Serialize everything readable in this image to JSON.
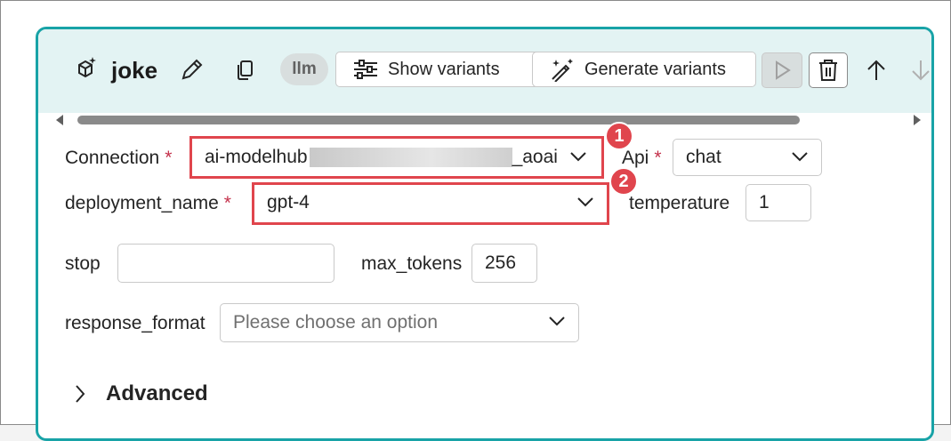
{
  "node": {
    "title": "joke",
    "badge": "llm",
    "buttons": {
      "show_variants": "Show variants",
      "generate_variants": "Generate variants"
    }
  },
  "form": {
    "connection": {
      "label": "Connection",
      "value_prefix": "ai-modelhub",
      "value_suffix": "_aoai",
      "required": "*"
    },
    "api": {
      "label": "Api",
      "value": "chat",
      "required": "*"
    },
    "deployment_name": {
      "label": "deployment_name",
      "value": "gpt-4",
      "required": "*"
    },
    "temperature": {
      "label": "temperature",
      "value": "1"
    },
    "stop": {
      "label": "stop",
      "value": ""
    },
    "max_tokens": {
      "label": "max_tokens",
      "value": "256"
    },
    "response_format": {
      "label": "response_format",
      "placeholder": "Please choose an option"
    }
  },
  "advanced": {
    "label": "Advanced"
  },
  "annotations": {
    "marker1": "1",
    "marker2": "2"
  },
  "colors": {
    "accent": "#18a3a7",
    "highlight": "#e0454d",
    "header_bg": "#e3f3f3"
  }
}
